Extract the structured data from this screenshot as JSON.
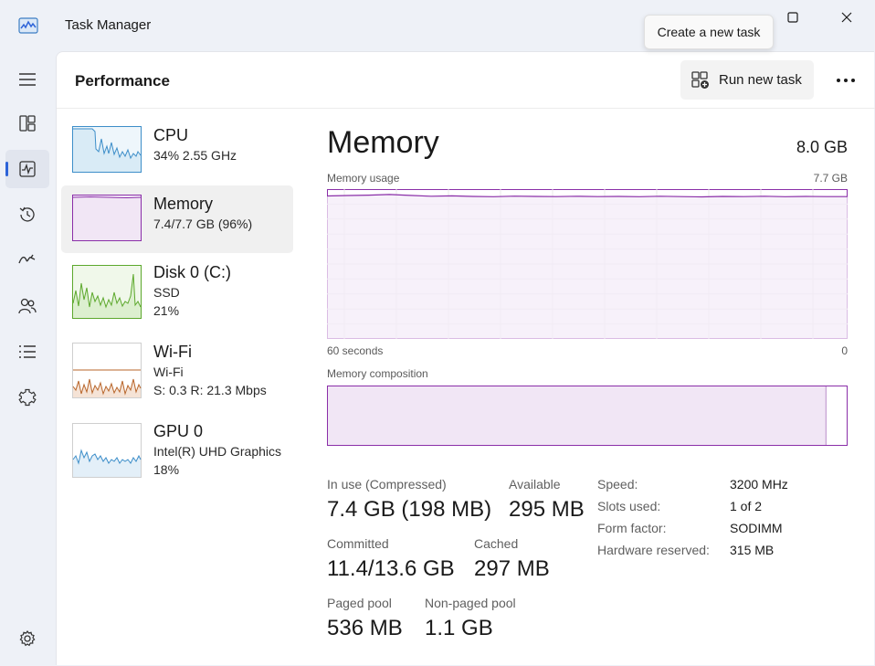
{
  "window": {
    "title": "Task Manager",
    "app_icon": "task-manager-chart-icon"
  },
  "tooltip": {
    "text": "Create a new task"
  },
  "nav": {
    "items": [
      {
        "name": "hamburger-menu-icon"
      },
      {
        "name": "processes-icon"
      },
      {
        "name": "performance-icon",
        "active": true
      },
      {
        "name": "app-history-icon"
      },
      {
        "name": "startup-apps-icon"
      },
      {
        "name": "users-icon"
      },
      {
        "name": "details-icon"
      },
      {
        "name": "services-icon"
      },
      {
        "name": "settings-icon"
      }
    ]
  },
  "header": {
    "title": "Performance",
    "run_task_label": "Run new task",
    "more_icon": "more-options-icon"
  },
  "resources": [
    {
      "name": "CPU",
      "sub1": "34%  2.55 GHz",
      "sub2": ""
    },
    {
      "name": "Memory",
      "sub1": "7.4/7.7 GB (96%)",
      "sub2": "",
      "active": true
    },
    {
      "name": "Disk 0 (C:)",
      "sub1": "SSD",
      "sub2": "21%"
    },
    {
      "name": "Wi-Fi",
      "sub1": "Wi-Fi",
      "sub2": "S: 0.3  R: 21.3 Mbps"
    },
    {
      "name": "GPU 0",
      "sub1": "Intel(R) UHD Graphics",
      "sub2": "18%"
    }
  ],
  "detail": {
    "title": "Memory",
    "total": "8.0 GB",
    "usage_caption": "Memory usage",
    "usage_max": "7.7 GB",
    "time_left": "60 seconds",
    "time_right": "0",
    "composition_caption": "Memory composition",
    "usage_level_percent": 96,
    "composition_in_use_percent": 96,
    "colors": {
      "memory_line": "#8a2ea8",
      "memory_fill": "#f1e6f5",
      "cpu": "#3d8ec9",
      "disk": "#5ca82c",
      "wifi": "#b8652a",
      "gpu": "#3d8ec9"
    }
  },
  "stats": {
    "in_use_label": "In use (Compressed)",
    "in_use_value": "7.4 GB (198 MB)",
    "available_label": "Available",
    "available_value": "295 MB",
    "committed_label": "Committed",
    "committed_value": "11.4/13.6 GB",
    "cached_label": "Cached",
    "cached_value": "297 MB",
    "paged_label": "Paged pool",
    "paged_value": "536 MB",
    "nonpaged_label": "Non-paged pool",
    "nonpaged_value": "1.1 GB"
  },
  "specs": [
    {
      "label": "Speed:",
      "value": "3200 MHz"
    },
    {
      "label": "Slots used:",
      "value": "1 of 2"
    },
    {
      "label": "Form factor:",
      "value": "SODIMM"
    },
    {
      "label": "Hardware reserved:",
      "value": "315 MB"
    }
  ]
}
